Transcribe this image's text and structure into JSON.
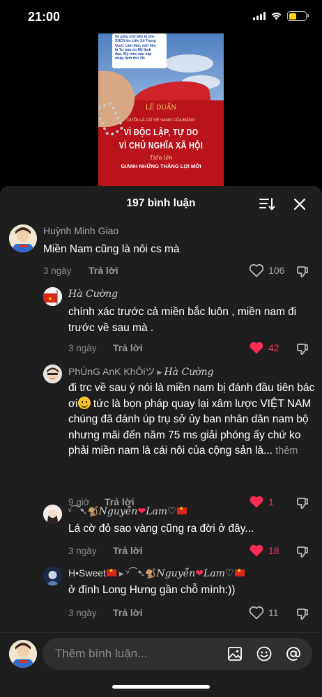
{
  "status_bar": {
    "time": "21:00",
    "icons": [
      "signal-icon",
      "wifi-icon",
      "battery-icon"
    ],
    "battery_color": "#ffd60a"
  },
  "video": {
    "caption_lines": [
      "hệ giữa một bên là phe",
      "XHCN do Liên Xô Trung",
      "Quốc cầm đầu, một bên",
      "là Tư bản do Mỹ lãnh",
      "đạo. Mỹ mèo nào sáp",
      "nhập lãnh thổ VN"
    ],
    "book": {
      "author": "LÊ DUẨN",
      "line1": "DƯỚI LÁ CỜ VẺ VANG CỦA ĐẢNG",
      "title1": "VÌ ĐỘC LẬP, TỰ DO",
      "title2": "VÌ CHỦ NGHĨA XÃ HỘI",
      "line2": "Tiến lên",
      "line3": "GIÀNH NHỮNG THẮNG LỢI MỚI"
    }
  },
  "comments_sheet": {
    "count_label": "197 bình luận",
    "accent_color": "#fe2c55",
    "comments": [
      {
        "author": "Huỳnh Minh Giao",
        "text": "Miền Nam cũng là nôi cs mà",
        "date": "3 ngày",
        "reply": "Trả lời",
        "likes": "106",
        "liked": false
      },
      {
        "author": "Hà Cường",
        "text": "chính xác trước cả miền bắc luôn , miền nam đi trước về sau mà .",
        "date": "3 ngày",
        "reply": "Trả lời",
        "likes": "42",
        "liked": true
      },
      {
        "author": "PhÙnG AnK KhÔiツ",
        "reply_to": "Hà Cường",
        "text_before_emoji": "đi trc về sau ý nói là miền nam bị đánh đầu tiên bác ơi",
        "text_after_emoji": " tức là bọn pháp quay lại xâm lược VIỆT NAM chúng đã đánh úp trụ sở ủy ban nhân dân nam bộ nhưng mãi đến năm 75 ms giải phóng ấy chứ ko phải miền nam là cái nôi của cộng sản là...",
        "more": "thêm",
        "date": "9 giờ",
        "reply": "Trả lời",
        "likes": "1",
        "liked": true
      },
      {
        "author_prefix": "ᵛ⁀➷",
        "author": "Nguyễn",
        "author_suffix": "Lam♡",
        "text": "Lá cờ đỏ sao vàng cũng ra đời ở đây...",
        "date": "3 ngày",
        "reply": "Trả lời",
        "likes": "18",
        "liked": true
      },
      {
        "author": "H•Sweet",
        "reply_to_prefix": "ᵛ⁀➷",
        "reply_to": "Nguyễn",
        "reply_to_suffix": "Lam♡",
        "text": "ở đình Long Hưng gần chỗ mình:))",
        "date": "3 ngày",
        "reply": "Trả lời",
        "likes": "11",
        "liked": false
      }
    ]
  },
  "comment_input": {
    "placeholder": "Thêm bình luận...",
    "icons": [
      "image-icon",
      "emoji-icon",
      "mention-icon"
    ]
  }
}
